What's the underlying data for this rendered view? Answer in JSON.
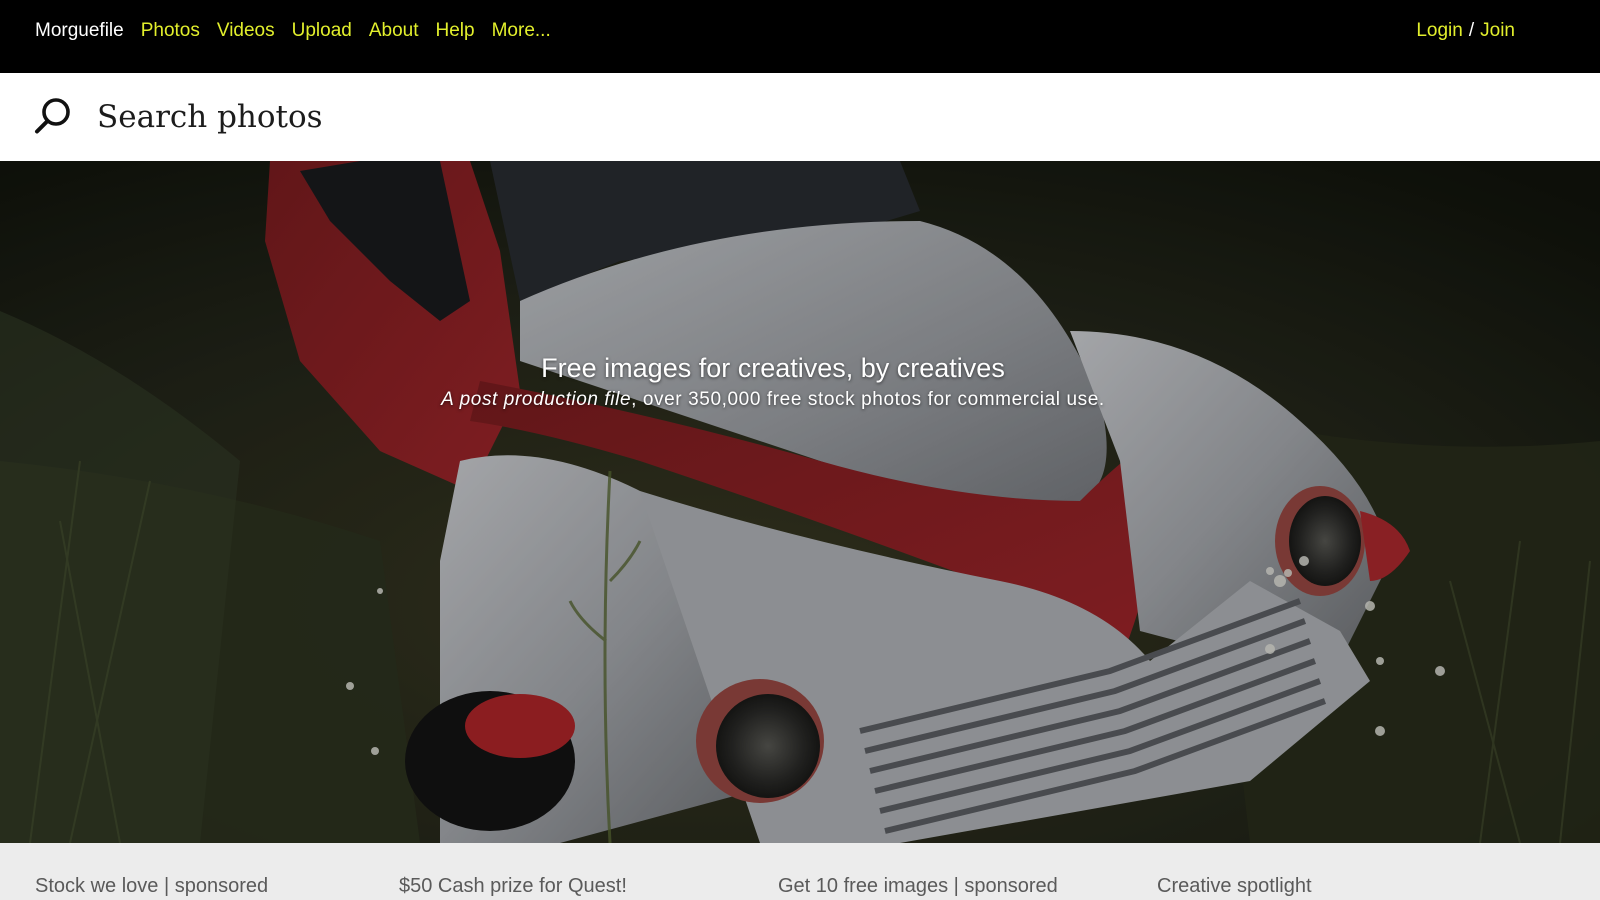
{
  "nav": {
    "brand": "Morguefile",
    "links": [
      "Photos",
      "Videos",
      "Upload",
      "About",
      "Help",
      "More..."
    ],
    "login": "Login",
    "separator": "/",
    "join": "Join"
  },
  "search": {
    "placeholder": "Search photos",
    "icon": "search-icon"
  },
  "hero": {
    "title": "Free images for creatives, by creatives",
    "subtitle_emphasis": "A post production file",
    "subtitle_rest": ", over 350,000 free stock photos for commercial use."
  },
  "promos": [
    "Stock we love | sponsored",
    "$50 Cash prize for Quest!",
    "Get 10 free images | sponsored",
    "Creative spotlight"
  ],
  "colors": {
    "nav_background": "#000000",
    "nav_link": "#e2ef2c",
    "brand_text": "#ffffff",
    "promo_background": "#ececec"
  }
}
